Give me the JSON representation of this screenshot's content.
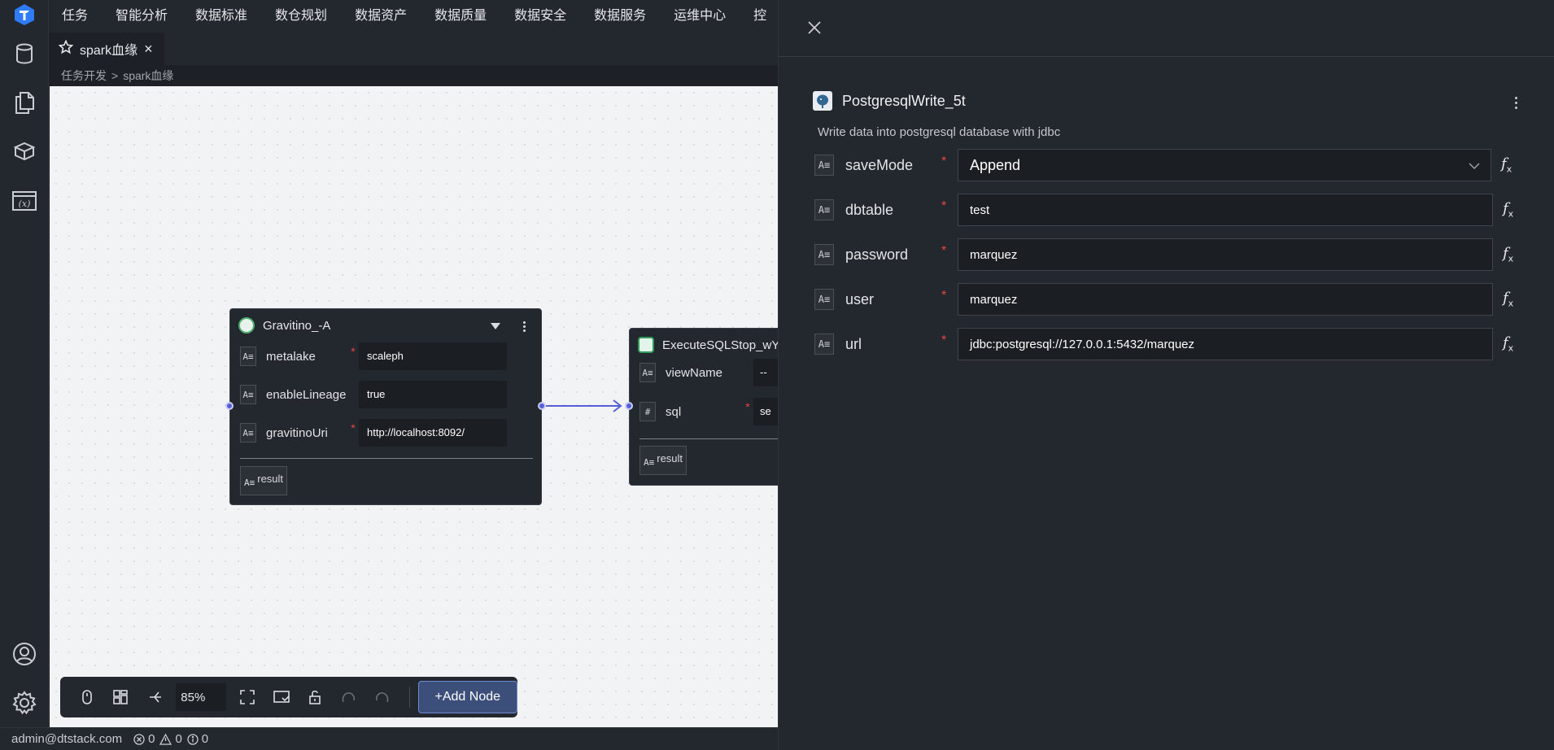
{
  "app": {
    "logo_icon": "app-logo-icon"
  },
  "rail": {
    "items": [
      {
        "icon": "database-icon"
      },
      {
        "icon": "files-icon"
      },
      {
        "icon": "cube-icon"
      },
      {
        "icon": "variable-icon",
        "label": "(x)"
      }
    ],
    "bottom": [
      {
        "icon": "user-icon"
      },
      {
        "icon": "settings-gear-icon"
      }
    ]
  },
  "topmenu": [
    "任务",
    "智能分析",
    "数据标准",
    "数仓规划",
    "数据资产",
    "数据质量",
    "数据安全",
    "数据服务",
    "运维中心",
    "控"
  ],
  "tabs": [
    {
      "label": "spark血缘",
      "icon": "star-icon",
      "close": "×"
    }
  ],
  "breadcrumb": {
    "parent": "任务开发",
    "sep": ">",
    "current": "spark血缘"
  },
  "nodes": {
    "gravitino": {
      "title": "Gravitino_-A",
      "params": [
        {
          "label": "metalake",
          "required": "*",
          "value": "scaleph"
        },
        {
          "label": "enableLineage",
          "required": "",
          "value": "true"
        },
        {
          "label": "gravitinoUri",
          "required": "*",
          "value": "http://localhost:8092/"
        }
      ],
      "result": "result"
    },
    "executesql": {
      "title": "ExecuteSQLStop_wY",
      "params": [
        {
          "label": "viewName",
          "required": "",
          "value": "--"
        },
        {
          "label": "sql",
          "required": "*",
          "value": "se"
        }
      ],
      "result": "result"
    }
  },
  "toolbar": {
    "zoom": "85%",
    "add_node": "+Add Node",
    "tools": [
      "mouse-icon",
      "layout-grid-icon",
      "branch-icon",
      "fullscreen-icon",
      "minimap-icon",
      "lock-icon",
      "undo-icon",
      "redo-icon"
    ]
  },
  "status": {
    "user": "admin@dtstack.com",
    "errors": "0",
    "warnings": "0",
    "infos": "0"
  },
  "panel": {
    "title": "PostgresqlWrite_5t",
    "description": "Write data into postgresql database with jdbc",
    "fields": [
      {
        "label": "saveMode",
        "required": "*",
        "value": "Append",
        "type": "select"
      },
      {
        "label": "dbtable",
        "required": "*",
        "value": "test",
        "type": "input"
      },
      {
        "label": "password",
        "required": "*",
        "value": "marquez",
        "type": "input"
      },
      {
        "label": "user",
        "required": "*",
        "value": "marquez",
        "type": "input"
      },
      {
        "label": "url",
        "required": "*",
        "value": "jdbc:postgresql://127.0.0.1:5432/marquez",
        "type": "input"
      }
    ]
  }
}
